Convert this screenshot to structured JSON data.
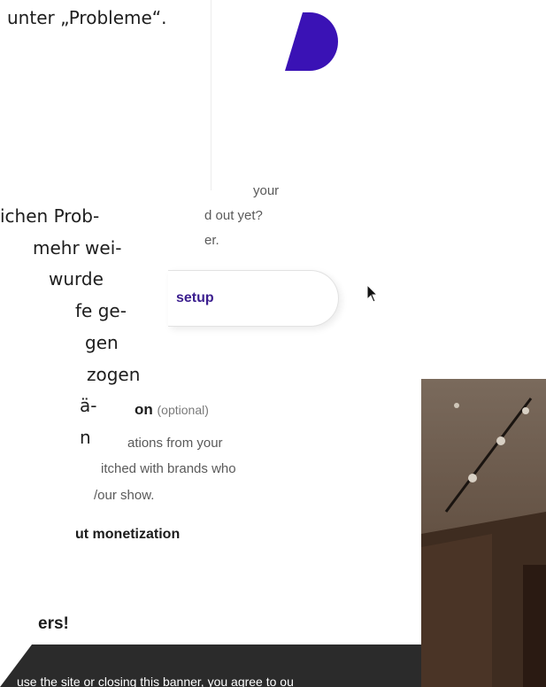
{
  "left_article": {
    "top_line": "unter „Probleme“.",
    "lines": [
      "ichen Prob-",
      "mehr wei-",
      "wurde",
      "fe ge-",
      "gen",
      "zogen",
      "ä-",
      "n"
    ]
  },
  "podcast_setup": {
    "text_lines": [
      "your",
      "d out yet?",
      "er."
    ],
    "button_label": "setup"
  },
  "monetization": {
    "heading": "on",
    "heading_optional": "(optional)",
    "text_lines": [
      "ations from your",
      "itched with brands who",
      "/our show."
    ],
    "link": "ut monetization"
  },
  "footer_heading": "ers!",
  "cookie_banner": {
    "text": "use the site or closing this banner, you agree to ou"
  },
  "colors": {
    "brand_purple": "#3a12b5",
    "banner_dark": "#2b2b2b",
    "button_text": "#3c1f8f"
  },
  "icons": {
    "logo": "half-circle-logo",
    "cursor": "mouse-pointer"
  }
}
